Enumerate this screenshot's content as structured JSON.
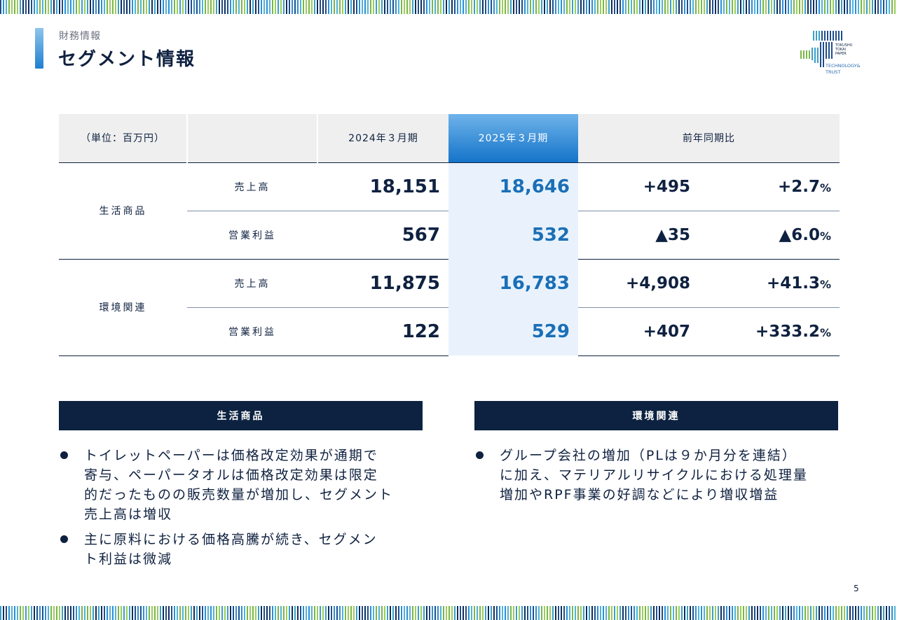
{
  "header": {
    "category": "財務情報",
    "title": "セグメント情報"
  },
  "logo": {
    "lines": [
      "TOKUSHU",
      "TOKAI",
      "PAPER"
    ],
    "tagline_1": "TECHNOLOGY&",
    "tagline_2": "TRUST"
  },
  "table": {
    "unit_label": "（単位：百万円）",
    "col_prev": "2024年３月期",
    "col_curr": "2025年３月期",
    "col_yoy": "前年同期比",
    "segments": [
      {
        "name": "生活商品",
        "rows": [
          {
            "metric": "売上高",
            "prev": "18,151",
            "curr": "18,646",
            "diff": "+495",
            "pct": "+2.7",
            "pct_unit": "%"
          },
          {
            "metric": "営業利益",
            "prev": "567",
            "curr": "532",
            "diff": "▲35",
            "pct": "▲6.0",
            "pct_unit": "%"
          }
        ]
      },
      {
        "name": "環境関連",
        "rows": [
          {
            "metric": "売上高",
            "prev": "11,875",
            "curr": "16,783",
            "diff": "+4,908",
            "pct": "+41.3",
            "pct_unit": "%"
          },
          {
            "metric": "営業利益",
            "prev": "122",
            "curr": "529",
            "diff": "+407",
            "pct": "+333.2",
            "pct_unit": "%"
          }
        ]
      }
    ]
  },
  "boxes": [
    {
      "title": "生活商品",
      "bullets": [
        [
          "トイレットペーパーは価格改定効果が通期で",
          "寄与、ペーパータオルは価格改定効果は限定",
          "的だったものの販売数量が増加し、セグメント",
          "売上高は増収"
        ],
        [
          "主に原料における価格高騰が続き、セグメン",
          "ト利益は微減"
        ]
      ]
    },
    {
      "title": "環境関連",
      "bullets": [
        [
          "グループ会社の増加（PLは９か月分を連結）",
          "に加え、マテリアルリサイクルにおける処理量",
          "増加やRPF事業の好調などにより増収増益"
        ]
      ]
    }
  ],
  "page_number": "5",
  "colors": {
    "navy": "#0c2240",
    "accent_blue": "#1a6fb7",
    "highlight_bg": "#e9f2fc"
  }
}
